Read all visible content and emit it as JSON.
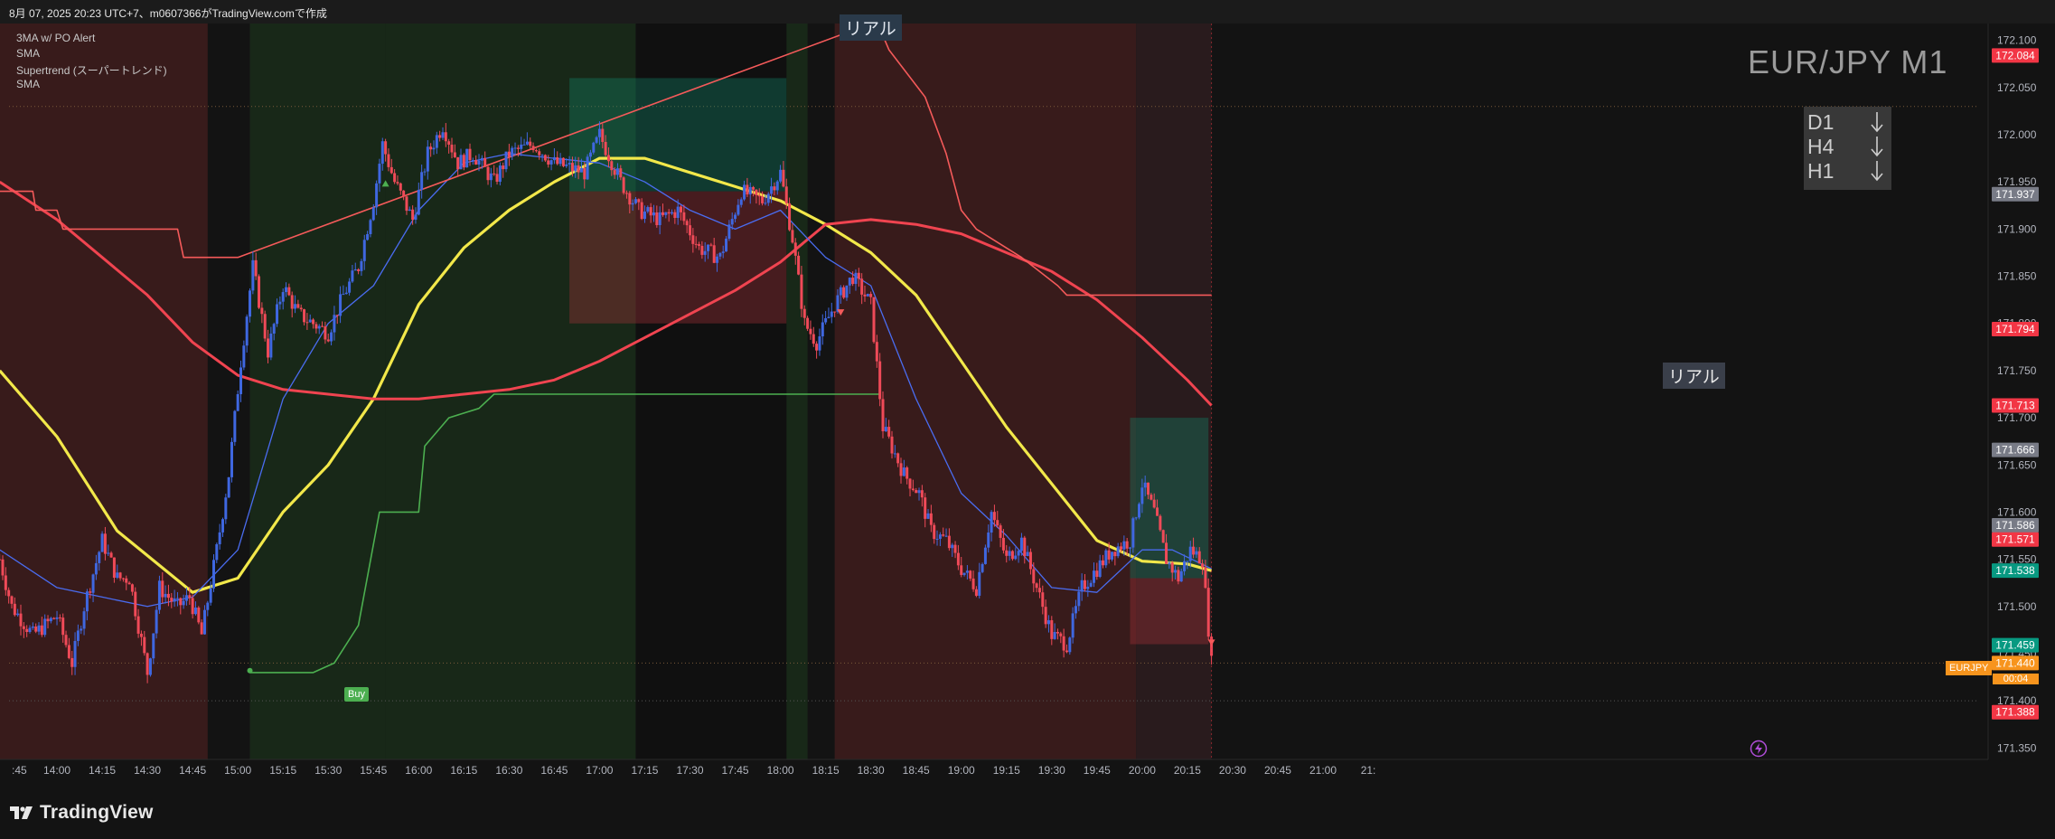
{
  "header": {
    "caption": "8月 07, 2025 20:23 UTC+7、m0607366がTradingView.comで作成"
  },
  "indicators": [
    "3MA w/ PO Alert",
    "SMA",
    "Supertrend (スーパートレンド)",
    "SMA"
  ],
  "symbol_title": "EUR/JPY M1",
  "mtf_panel": [
    {
      "tf": "D1",
      "direction_icon": "arrow-down-icon"
    },
    {
      "tf": "H4",
      "direction_icon": "arrow-down-icon"
    },
    {
      "tf": "H1",
      "direction_icon": "arrow-down-icon"
    }
  ],
  "labels": {
    "real_top": "リアル",
    "real_right": "リアル",
    "buy": "Buy"
  },
  "symbol_badge": "EURJPY",
  "countdown": "00:04",
  "branding": "TradingView",
  "colors": {
    "background": "#131313",
    "bear_zone": "#3a1b1b",
    "bull_zone": "#1a2b1a",
    "candle_up": "#3f67e0",
    "candle_down": "#ef4a58",
    "ma_yellow": "#f2e84a",
    "ma_red": "#f04450",
    "ma_blue": "#4a6cf0",
    "supertrend_green": "#4caf50",
    "supertrend_red": "#f45a5a",
    "price_orange": "#f7941d",
    "teal": "#10896e"
  },
  "chart_data": {
    "type": "candlestick",
    "symbol": "EUR/JPY",
    "timeframe": "M1",
    "x_ticks": [
      ":45",
      "14:00",
      "14:15",
      "14:30",
      "14:45",
      "15:00",
      "15:15",
      "15:30",
      "15:45",
      "16:00",
      "16:15",
      "16:30",
      "16:45",
      "17:00",
      "17:15",
      "17:30",
      "17:45",
      "18:00",
      "18:15",
      "18:30",
      "18:45",
      "19:00",
      "19:15",
      "19:30",
      "19:45",
      "20:00",
      "20:15",
      "20:30",
      "20:45",
      "21:00",
      "21:"
    ],
    "y_ticks": [
      "172.100",
      "172.050",
      "172.000",
      "171.950",
      "171.900",
      "171.850",
      "171.800",
      "171.750",
      "171.700",
      "171.650",
      "171.600",
      "171.550",
      "171.500",
      "171.450",
      "171.400",
      "171.350"
    ],
    "ylim": [
      171.335,
      172.115
    ],
    "price_labels": [
      {
        "value": "172.084",
        "color": "#f23645"
      },
      {
        "value": "171.937",
        "color": "#787b86"
      },
      {
        "value": "171.794",
        "color": "#f23645"
      },
      {
        "value": "171.713",
        "color": "#f23645"
      },
      {
        "value": "171.666",
        "color": "#787b86"
      },
      {
        "value": "171.586",
        "color": "#787b86"
      },
      {
        "value": "171.571",
        "color": "#f23645"
      },
      {
        "value": "171.538",
        "color": "#089981"
      },
      {
        "value": "171.459",
        "color": "#089981"
      },
      {
        "value": "171.440",
        "color": "#f7941d"
      },
      {
        "value": "171.388",
        "color": "#f23645"
      }
    ],
    "last_price": 171.44,
    "ohlc_path": [
      [
        "13:41",
        171.55
      ],
      [
        "13:45",
        171.5
      ],
      [
        "13:52",
        171.47
      ],
      [
        "14:00",
        171.49
      ],
      [
        "14:05",
        171.44
      ],
      [
        "14:09",
        171.5
      ],
      [
        "14:15",
        171.57
      ],
      [
        "14:20",
        171.53
      ],
      [
        "14:24",
        171.53
      ],
      [
        "14:30",
        171.43
      ],
      [
        "14:34",
        171.52
      ],
      [
        "14:40",
        171.5
      ],
      [
        "14:44",
        171.51
      ],
      [
        "14:48",
        171.47
      ],
      [
        "14:53",
        171.56
      ],
      [
        "14:57",
        171.64
      ],
      [
        "15:01",
        171.76
      ],
      [
        "15:05",
        171.86
      ],
      [
        "15:10",
        171.77
      ],
      [
        "15:15",
        171.84
      ],
      [
        "15:20",
        171.81
      ],
      [
        "15:25",
        171.8
      ],
      [
        "15:30",
        171.79
      ],
      [
        "15:35",
        171.83
      ],
      [
        "15:40",
        171.86
      ],
      [
        "15:45",
        171.93
      ],
      [
        "15:48",
        171.99
      ],
      [
        "15:52",
        171.95
      ],
      [
        "15:58",
        171.91
      ],
      [
        "16:03",
        171.98
      ],
      [
        "16:08",
        172.01
      ],
      [
        "16:13",
        171.97
      ],
      [
        "16:18",
        171.98
      ],
      [
        "16:25",
        171.95
      ],
      [
        "16:30",
        171.98
      ],
      [
        "16:38",
        171.99
      ],
      [
        "16:45",
        171.97
      ],
      [
        "16:55",
        171.96
      ],
      [
        "17:00",
        172.0
      ],
      [
        "17:07",
        171.95
      ],
      [
        "17:13",
        171.92
      ],
      [
        "17:20",
        171.91
      ],
      [
        "17:26",
        171.92
      ],
      [
        "17:33",
        171.88
      ],
      [
        "17:40",
        171.87
      ],
      [
        "17:47",
        171.94
      ],
      [
        "17:54",
        171.93
      ],
      [
        "18:00",
        171.96
      ],
      [
        "18:04",
        171.89
      ],
      [
        "18:08",
        171.8
      ],
      [
        "18:12",
        171.78
      ],
      [
        "18:18",
        171.82
      ],
      [
        "18:24",
        171.85
      ],
      [
        "18:30",
        171.82
      ],
      [
        "18:34",
        171.69
      ],
      [
        "18:41",
        171.64
      ],
      [
        "18:46",
        171.62
      ],
      [
        "18:50",
        171.58
      ],
      [
        "18:55",
        171.57
      ],
      [
        "19:00",
        171.54
      ],
      [
        "19:05",
        171.52
      ],
      [
        "19:10",
        171.6
      ],
      [
        "19:15",
        171.55
      ],
      [
        "19:20",
        171.57
      ],
      [
        "19:25",
        171.52
      ],
      [
        "19:30",
        171.47
      ],
      [
        "19:35",
        171.46
      ],
      [
        "19:40",
        171.52
      ],
      [
        "19:45",
        171.54
      ],
      [
        "19:50",
        171.56
      ],
      [
        "19:56",
        171.57
      ],
      [
        "20:00",
        171.63
      ],
      [
        "20:04",
        171.6
      ],
      [
        "20:08",
        171.55
      ],
      [
        "20:12",
        171.53
      ],
      [
        "20:16",
        171.56
      ],
      [
        "20:20",
        171.55
      ],
      [
        "20:23",
        171.44
      ]
    ],
    "series": [
      {
        "type": "sma",
        "points": [
          [
            "13:41",
            171.75
          ],
          [
            "14:00",
            171.68
          ],
          [
            "14:20",
            171.58
          ],
          [
            "14:45",
            171.515
          ],
          [
            "15:00",
            171.53
          ],
          [
            "15:15",
            171.6
          ],
          [
            "15:30",
            171.65
          ],
          [
            "15:45",
            171.72
          ],
          [
            "16:00",
            171.82
          ],
          [
            "16:15",
            171.88
          ],
          [
            "16:30",
            171.92
          ],
          [
            "16:45",
            171.95
          ],
          [
            "17:00",
            171.975
          ],
          [
            "17:15",
            171.975
          ],
          [
            "17:30",
            171.96
          ],
          [
            "17:45",
            171.945
          ],
          [
            "18:00",
            171.93
          ],
          [
            "18:15",
            171.905
          ],
          [
            "18:30",
            171.875
          ],
          [
            "18:45",
            171.83
          ],
          [
            "19:00",
            171.76
          ],
          [
            "19:15",
            171.69
          ],
          [
            "19:30",
            171.63
          ],
          [
            "19:45",
            171.57
          ],
          [
            "20:00",
            171.548
          ],
          [
            "20:15",
            171.545
          ],
          [
            "20:23",
            171.538
          ]
        ]
      },
      {
        "type": "sma",
        "points": [
          [
            "13:41",
            171.95
          ],
          [
            "14:00",
            171.91
          ],
          [
            "14:15",
            171.87
          ],
          [
            "14:30",
            171.83
          ],
          [
            "14:45",
            171.78
          ],
          [
            "15:00",
            171.745
          ],
          [
            "15:15",
            171.73
          ],
          [
            "15:30",
            171.725
          ],
          [
            "15:45",
            171.72
          ],
          [
            "16:00",
            171.72
          ],
          [
            "16:15",
            171.725
          ],
          [
            "16:30",
            171.73
          ],
          [
            "16:45",
            171.74
          ],
          [
            "17:00",
            171.76
          ],
          [
            "17:15",
            171.785
          ],
          [
            "17:30",
            171.81
          ],
          [
            "17:45",
            171.835
          ],
          [
            "18:00",
            171.865
          ],
          [
            "18:15",
            171.905
          ],
          [
            "18:30",
            171.91
          ],
          [
            "18:45",
            171.905
          ],
          [
            "19:00",
            171.895
          ],
          [
            "19:15",
            171.875
          ],
          [
            "19:30",
            171.855
          ],
          [
            "19:45",
            171.825
          ],
          [
            "20:00",
            171.785
          ],
          [
            "20:15",
            171.74
          ],
          [
            "20:23",
            171.713
          ]
        ]
      },
      {
        "type": "sma_fast",
        "points": [
          [
            "13:41",
            171.56
          ],
          [
            "14:00",
            171.52
          ],
          [
            "14:15",
            171.51
          ],
          [
            "14:30",
            171.5
          ],
          [
            "14:45",
            171.51
          ],
          [
            "15:00",
            171.56
          ],
          [
            "15:15",
            171.72
          ],
          [
            "15:30",
            171.8
          ],
          [
            "15:45",
            171.84
          ],
          [
            "16:00",
            171.92
          ],
          [
            "16:15",
            171.97
          ],
          [
            "16:30",
            171.98
          ],
          [
            "16:45",
            171.975
          ],
          [
            "17:00",
            171.97
          ],
          [
            "17:15",
            171.95
          ],
          [
            "17:30",
            171.92
          ],
          [
            "17:45",
            171.9
          ],
          [
            "18:00",
            171.92
          ],
          [
            "18:15",
            171.87
          ],
          [
            "18:30",
            171.84
          ],
          [
            "18:45",
            171.72
          ],
          [
            "19:00",
            171.62
          ],
          [
            "19:15",
            171.575
          ],
          [
            "19:30",
            171.52
          ],
          [
            "19:45",
            171.515
          ],
          [
            "20:00",
            171.56
          ],
          [
            "20:10",
            171.56
          ],
          [
            "20:23",
            171.54
          ]
        ]
      },
      {
        "type": "supertrend_down",
        "points": [
          [
            "13:41",
            171.94
          ],
          [
            "13:52",
            171.94
          ],
          [
            "13:53",
            171.92
          ],
          [
            "14:00",
            171.92
          ],
          [
            "14:02",
            171.9
          ],
          [
            "14:40",
            171.9
          ],
          [
            "14:42",
            171.87
          ],
          [
            "15:00",
            171.87
          ],
          [
            "18:32",
            172.12
          ],
          [
            "18:36",
            172.09
          ],
          [
            "18:48",
            172.04
          ],
          [
            "18:55",
            171.98
          ],
          [
            "19:00",
            171.92
          ],
          [
            "19:05",
            171.9
          ],
          [
            "19:20",
            171.87
          ],
          [
            "19:32",
            171.84
          ],
          [
            "19:35",
            171.83
          ],
          [
            "20:23",
            171.83
          ]
        ]
      },
      {
        "type": "supertrend_up",
        "points": [
          [
            "15:04",
            171.43
          ],
          [
            "15:25",
            171.43
          ],
          [
            "15:32",
            171.44
          ],
          [
            "15:40",
            171.48
          ],
          [
            "15:47",
            171.6
          ],
          [
            "16:00",
            171.6
          ],
          [
            "16:02",
            171.67
          ],
          [
            "16:10",
            171.7
          ],
          [
            "16:20",
            171.71
          ],
          [
            "16:25",
            171.725
          ],
          [
            "18:33",
            171.725
          ]
        ]
      }
    ],
    "zones": [
      {
        "kind": "bear",
        "from": "13:41",
        "to": "14:50"
      },
      {
        "kind": "bull",
        "from": "15:04",
        "to": "15:49"
      },
      {
        "kind": "bull",
        "from": "15:49",
        "to": "17:12"
      },
      {
        "kind": "bull",
        "from": "18:02",
        "to": "18:09"
      },
      {
        "kind": "bear",
        "from": "18:18",
        "to": "19:58"
      },
      {
        "kind": "bear_soft",
        "from": "19:58",
        "to": "20:23"
      }
    ],
    "positions": [
      {
        "from": "16:50",
        "to": "18:02",
        "entry": 171.94,
        "target": 172.06,
        "stop": 171.8
      },
      {
        "from": "19:56",
        "to": "20:22",
        "entry": 171.53,
        "target": 171.7,
        "stop": 171.46
      }
    ]
  }
}
